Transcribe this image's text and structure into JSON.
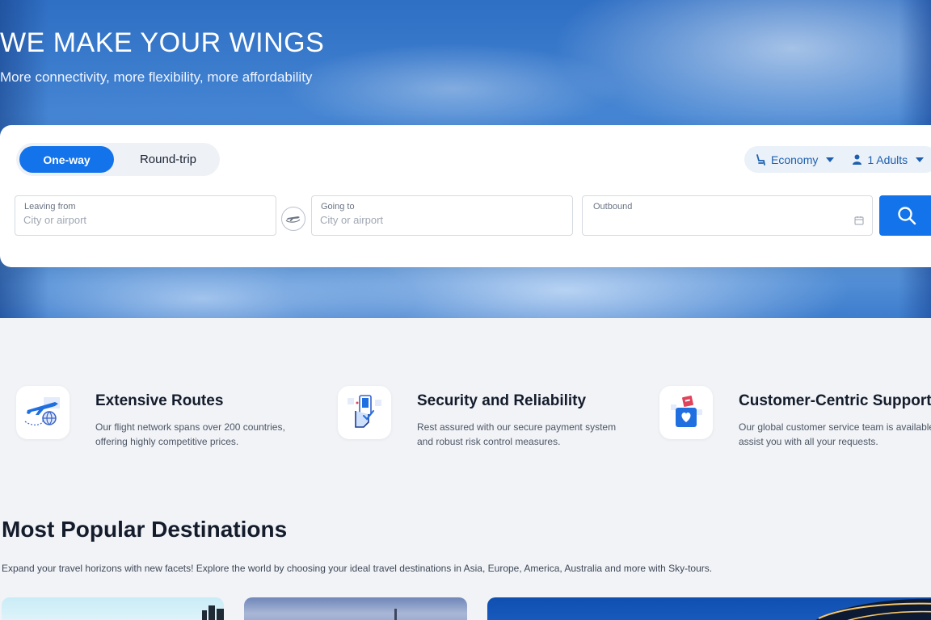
{
  "hero": {
    "title": "WE MAKE YOUR WINGS",
    "subtitle": "More connectivity, more flexibility, more affordability"
  },
  "search": {
    "trip_types": [
      {
        "label": "One-way",
        "selected": true
      },
      {
        "label": "Round-trip",
        "selected": false
      }
    ],
    "cabin_class": "Economy",
    "passengers": "1 Adults",
    "leaving_from": {
      "label": "Leaving from",
      "placeholder": "City or airport",
      "value": ""
    },
    "going_to": {
      "label": "Going to",
      "placeholder": "City or airport",
      "value": ""
    },
    "outbound": {
      "label": "Outbound",
      "value": ""
    },
    "accent_color": "#1273eb"
  },
  "features": [
    {
      "title": "Extensive Routes",
      "desc": "Our flight network spans over 200 countries, offering highly competitive prices.",
      "icon": "plane-globe-icon"
    },
    {
      "title": "Security and Reliability",
      "desc": "Rest assured with our secure payment system and robust risk control measures.",
      "icon": "secure-payment-icon"
    },
    {
      "title": "Customer-Centric Support",
      "desc": "Our global customer service team is available to assist you with all your requests.",
      "icon": "support-heart-icon"
    }
  ],
  "popular": {
    "title": "Most Popular Destinations",
    "desc": "Expand your travel horizons with new facets! Explore the world by choosing your ideal travel destinations in Asia, Europe, America, Australia and more with Sky-tours."
  }
}
